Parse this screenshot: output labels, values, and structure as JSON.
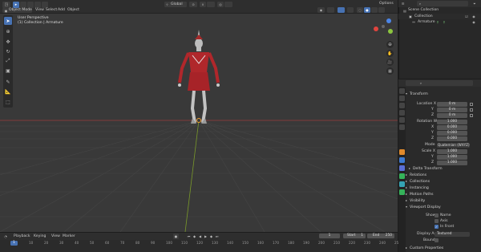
{
  "menu": {
    "mode": "Object Mode",
    "view": "View",
    "select": "Select",
    "add": "Add",
    "object": "Object",
    "transform_orient": "Global",
    "options": "Options"
  },
  "viewport": {
    "perspective": "User Perspective",
    "collection": "(1) Collection | Armature"
  },
  "outliner": {
    "title": "Scene Collection",
    "items": [
      {
        "name": "Collection"
      },
      {
        "name": "Armature"
      }
    ]
  },
  "properties": {
    "transform_header": "Transform",
    "location": {
      "label": "Location X",
      "y": "Y",
      "z": "Z",
      "x_val": "0 m",
      "y_val": "0 m",
      "z_val": "0 m"
    },
    "rotation": {
      "label": "Rotation W",
      "x": "X",
      "y": "Y",
      "z": "Z",
      "w_val": "1.000",
      "x_val": "0.000",
      "y_val": "0.000",
      "z_val": "0.000"
    },
    "mode": {
      "label": "Mode",
      "value": "Quaternion (WXYZ)"
    },
    "scale": {
      "label": "Scale X",
      "y": "Y",
      "z": "Z",
      "x_val": "1.000",
      "y_val": "1.000",
      "z_val": "1.000"
    },
    "sections": [
      "Delta Transform",
      "Relations",
      "Collections",
      "Instancing",
      "Motion Paths",
      "Visibility"
    ],
    "viewport_display": "Viewport Display",
    "show_label": "Show",
    "show_name": "Name",
    "show_axis": "Axis",
    "show_infront": "In Front",
    "display_as_label": "Display As",
    "display_as_value": "Textured",
    "bounds_label": "Bounds",
    "custom_props": "Custom Properties"
  },
  "timeline": {
    "playback": "Playback",
    "keying": "Keying",
    "view": "View",
    "marker": "Marker",
    "current": "1",
    "start_label": "Start",
    "start": "1",
    "end_label": "End",
    "end": "250",
    "ticks": [
      "0",
      "10",
      "20",
      "30",
      "40",
      "50",
      "60",
      "70",
      "80",
      "90",
      "100",
      "110",
      "120",
      "130",
      "140",
      "150",
      "160",
      "170",
      "180",
      "190",
      "200",
      "210",
      "220",
      "230",
      "240",
      "250"
    ],
    "frame_marker": "1"
  },
  "colors": {
    "accent": "#4772b3",
    "x_axis": "#e0443e",
    "y_axis": "#8cc63f",
    "z_axis": "#4c86e8"
  }
}
